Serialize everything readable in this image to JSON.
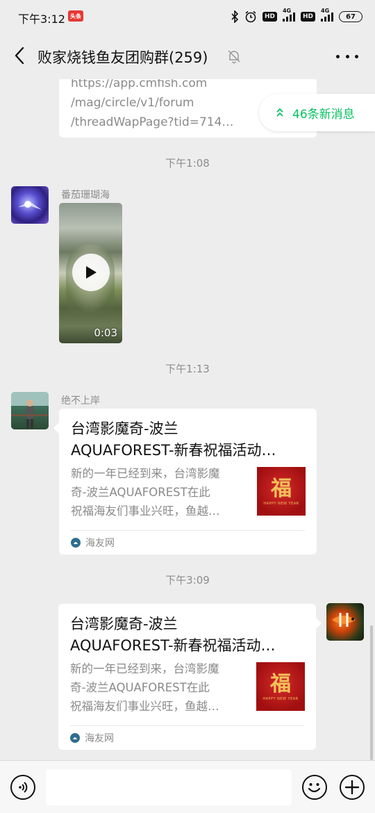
{
  "status_bar": {
    "time": "下午3:12",
    "app_badge": "头条",
    "hd1": "HD",
    "net1": "4G",
    "hd2": "HD",
    "net2": "4G",
    "battery": "67"
  },
  "header": {
    "title": "败家烧钱鱼友团购群(259)",
    "muted": true
  },
  "new_messages": {
    "label": "46条新消息"
  },
  "messages": {
    "link_bubble": {
      "text": "https://app.cmfish.com\n/mag/circle/v1/forum\n/threadWapPage?tid=714…"
    },
    "time_1": "下午1:08",
    "video": {
      "sender": "番茄珊瑚海",
      "duration": "0:03"
    },
    "time_2": "下午1:13",
    "card_1": {
      "sender": "绝不上岸",
      "title": "台湾影魔奇-波兰\nAQUAFOREST-新春祝福活动…",
      "desc": "新的一年已经到来，台湾影魔\n奇-波兰AQUAFOREST在此\n祝福海友们事业兴旺，鱼越…",
      "thumb_text": "福",
      "thumb_sub": "HAPPY NEW YEAR",
      "source": "海友网"
    },
    "time_3": "下午3:09",
    "card_2": {
      "title": "台湾影魔奇-波兰\nAQUAFOREST-新春祝福活动…",
      "desc": "新的一年已经到来，台湾影魔\n奇-波兰AQUAFOREST在此\n祝福海友们事业兴旺，鱼越…",
      "thumb_text": "福",
      "thumb_sub": "HAPPY NEW YEAR",
      "source": "海友网"
    }
  },
  "input_bar": {
    "placeholder": ""
  },
  "colors": {
    "accent_green": "#07c160",
    "background": "#ededed",
    "bubble": "#ffffff"
  }
}
